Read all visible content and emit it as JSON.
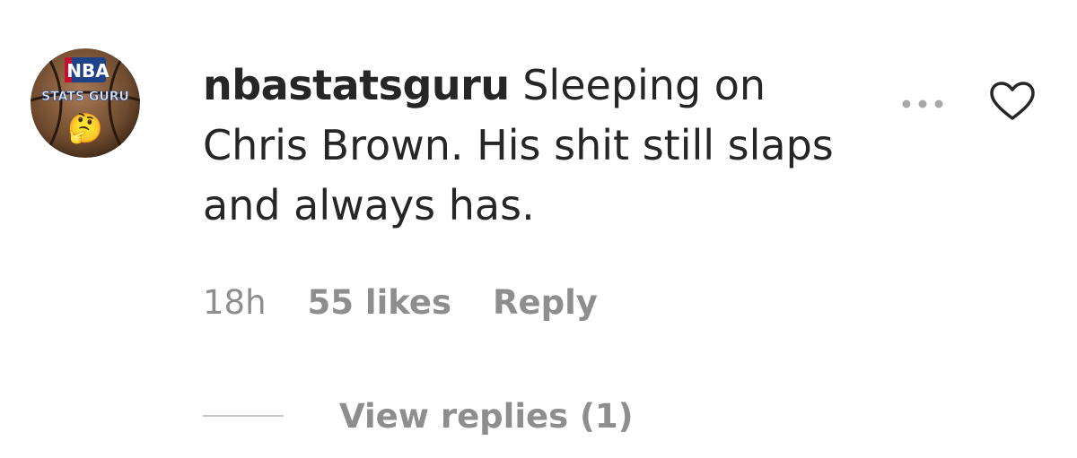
{
  "comment": {
    "username": "nbastatsguru",
    "text": "Sleeping on Chris Brown. His shit still slaps and always has.",
    "timestamp": "18h",
    "likes_label": "55 likes",
    "reply_label": "Reply",
    "view_replies_label": "View replies (1)",
    "avatar": {
      "logo_text": "NBA",
      "caption_text": "STATS GURU",
      "emoji": "🤔"
    }
  },
  "icons": {
    "more": "more-options-icon",
    "like": "heart-outline-icon"
  },
  "colors": {
    "primary_text": "#262626",
    "secondary_text": "#8e8e8e",
    "divider": "#c7c7c7",
    "background": "#ffffff"
  }
}
